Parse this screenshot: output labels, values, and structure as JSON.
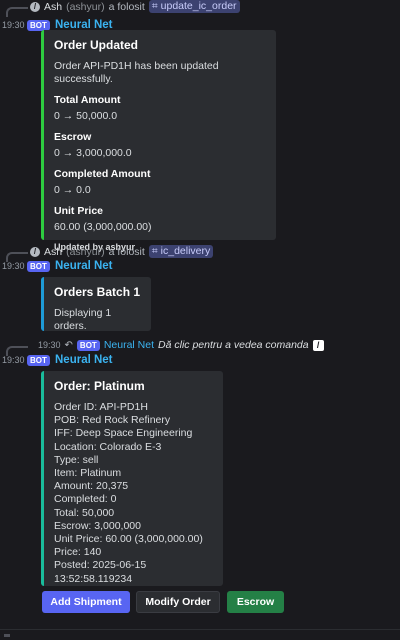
{
  "messages": [
    {
      "reply": {
        "user": "Ash",
        "handle": "(ashyur)",
        "action": "a folosit",
        "command": "update_ic_order"
      },
      "timestamp": "19:30",
      "bot_badge": "BOT",
      "author": "Neural Net",
      "embed": {
        "title": "Order Updated",
        "description": "Order API-PD1H has been updated successfully.",
        "fields": [
          {
            "name": "Total Amount",
            "value": "0 → 50,000.0"
          },
          {
            "name": "Escrow",
            "value": "0 → 3,000,000.0"
          },
          {
            "name": "Completed Amount",
            "value": "0 → 0.0"
          },
          {
            "name": "Unit Price",
            "value": "60.00 (3,000,000.00)"
          }
        ],
        "footer": "Updated by ashyur"
      }
    },
    {
      "reply": {
        "user": "Ash",
        "handle": "(ashyur)",
        "action": "a folosit",
        "command": "ic_delivery"
      },
      "timestamp": "19:30",
      "bot_badge": "BOT",
      "author": "Neural Net",
      "embed": {
        "title": "Orders Batch 1",
        "description": "Displaying 1 orders."
      }
    },
    {
      "reply": {
        "timestamp": "19:30",
        "bot_badge": "BOT",
        "author": "Neural Net",
        "text": "Dă clic pentru a vedea comanda"
      },
      "timestamp": "19:30",
      "bot_badge": "BOT",
      "author": "Neural Net",
      "embed": {
        "title": "Order: Platinum",
        "lines": [
          "Order ID: API-PD1H",
          "POB: Red Rock Refinery",
          "IFF: Deep Space Engineering",
          "Location: Colorado E-3",
          "Type: sell",
          "Item: Platinum",
          "Amount: 20,375",
          "Completed: 0",
          "Total: 50,000",
          "Escrow: 3,000,000",
          "Unit Price: 60.00 (3,000,000.00)",
          "Price: 140",
          "Posted: 2025-06-15 13:52:58.119234"
        ]
      },
      "buttons": [
        {
          "label": "Add Shipment",
          "style": "primary"
        },
        {
          "label": "Modify Order",
          "style": "secondary"
        },
        {
          "label": "Escrow",
          "style": "success"
        }
      ]
    }
  ],
  "colors": {
    "background": "#1a1a1e",
    "embed": "#2b2d31",
    "author": "#3bb3f0",
    "blurple": "#5865f2",
    "green": "#248046"
  }
}
